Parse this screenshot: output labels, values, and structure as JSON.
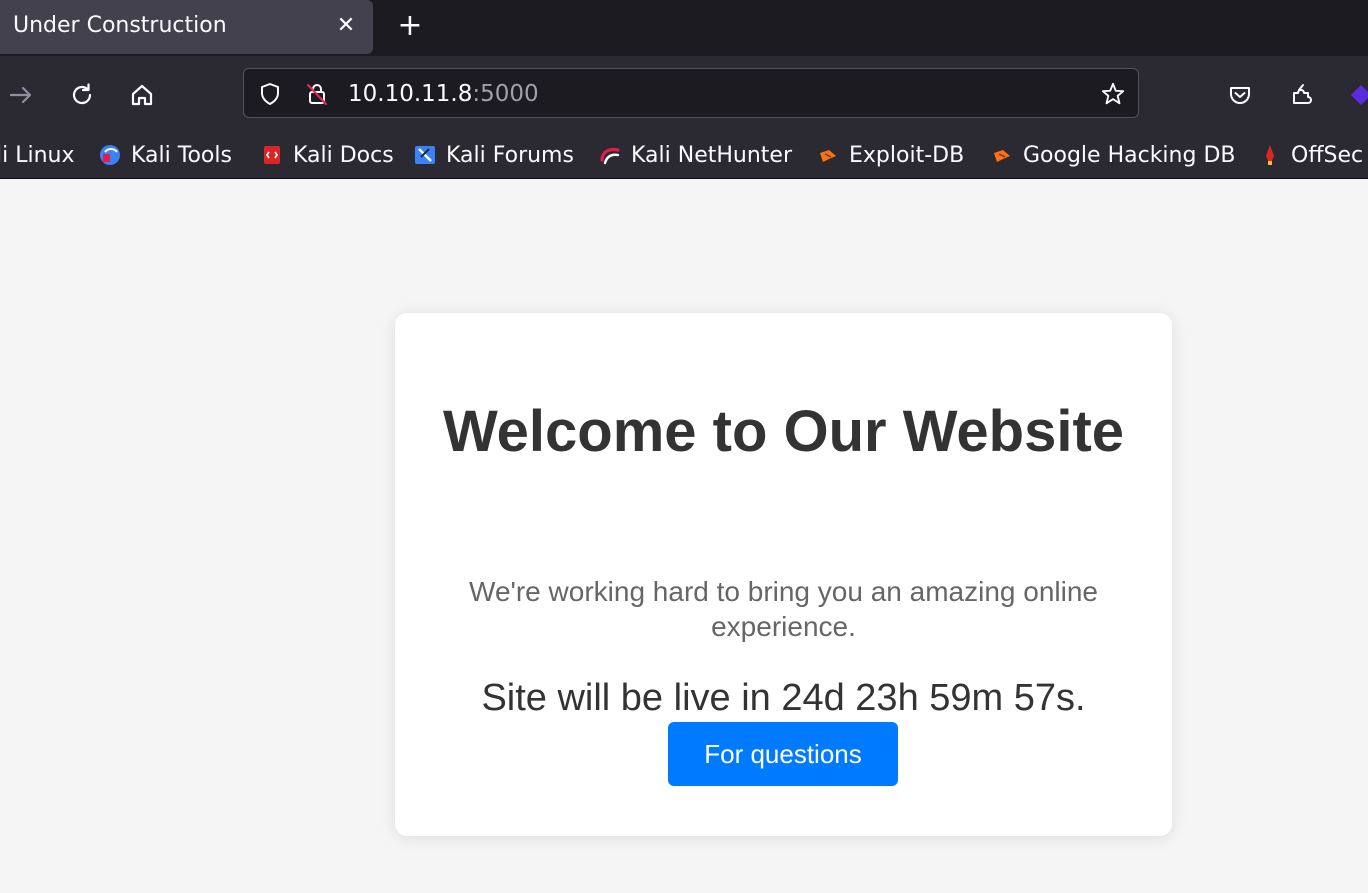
{
  "browser": {
    "tab": {
      "title": "Under Construction"
    },
    "url": {
      "host": "10.10.11.8",
      "port": ":5000"
    },
    "bookmarks": [
      {
        "label": "li Linux",
        "icon": "kali-icon"
      },
      {
        "label": "Kali Tools",
        "icon": "kali-tools-icon"
      },
      {
        "label": "Kali Docs",
        "icon": "kali-docs-icon"
      },
      {
        "label": "Kali Forums",
        "icon": "kali-forums-icon"
      },
      {
        "label": "Kali NetHunter",
        "icon": "nethunter-icon"
      },
      {
        "label": "Exploit-DB",
        "icon": "exploit-db-icon"
      },
      {
        "label": "Google Hacking DB",
        "icon": "ghdb-icon"
      },
      {
        "label": "OffSec",
        "icon": "offsec-icon"
      }
    ]
  },
  "page": {
    "heading": "Welcome to Our Website",
    "subtitle": "We're working hard to bring you an amazing online experience.",
    "countdown": "Site will be live in 24d 23h 59m 57s.",
    "cta_label": "For questions"
  },
  "colors": {
    "page_bg": "#f5f5f5",
    "button": "#007bff",
    "heading": "#333333",
    "subtitle": "#666666"
  }
}
